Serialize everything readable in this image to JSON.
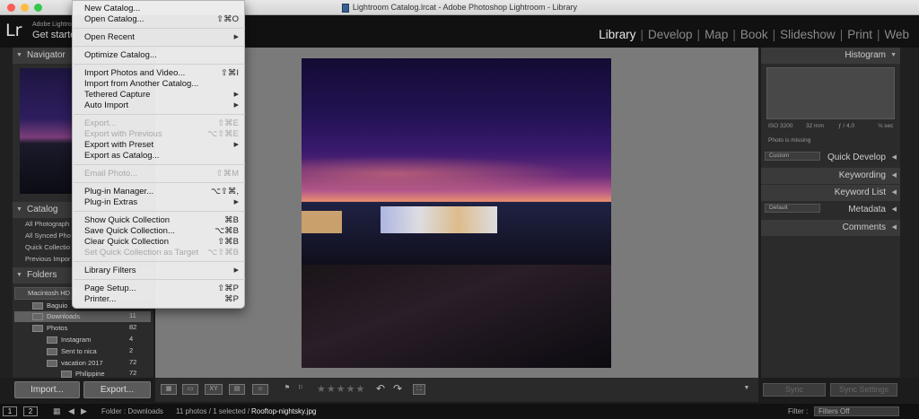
{
  "window": {
    "title": "Lightroom Catalog.lrcat - Adobe Photoshop Lightroom - Library"
  },
  "identity": {
    "logo": "Lr",
    "line1": "Adobe Lightroom",
    "line2": "Get starte"
  },
  "modules": [
    "Library",
    "Develop",
    "Map",
    "Book",
    "Slideshow",
    "Print",
    "Web"
  ],
  "left_panel": {
    "navigator": "Navigator",
    "catalog": "Catalog",
    "catalog_items": [
      "All Photograph",
      "All Synced Pho",
      "Quick Collectio",
      "Previous Impor"
    ],
    "folders": "Folders",
    "drive": "Macintosh HD",
    "folder_rows": [
      {
        "name": "Baguio",
        "count": ""
      },
      {
        "name": "Downloads",
        "count": "11"
      },
      {
        "name": "Photos",
        "count": "82"
      },
      {
        "name": "Instagram",
        "count": "4"
      },
      {
        "name": "Sent to nica",
        "count": "2"
      },
      {
        "name": "vacation 2017",
        "count": "72"
      },
      {
        "name": "Philippine",
        "count": "72"
      }
    ],
    "import_btn": "Import...",
    "export_btn": "Export..."
  },
  "right_panel": {
    "histogram": "Histogram",
    "iso": "ISO 3200",
    "focal": "32 mm",
    "aperture": "ƒ / 4,0",
    "shutter": "⅛ sec",
    "missing": "Photo is missing",
    "custom": "Custom",
    "default": "Default",
    "sections": [
      "Quick Develop",
      "Keywording",
      "Keyword List",
      "Metadata",
      "Comments"
    ],
    "sync": "Sync",
    "sync_settings": "Sync Settings"
  },
  "toolbar": {
    "stars": "★★★★★"
  },
  "filmstrip": {
    "page1": "1",
    "page2": "2",
    "folder": "Folder : Downloads",
    "count": "11 photos / 1 selected /",
    "file": "Rooftop-nightsky.jpg",
    "filter_label": "Filter :",
    "filter_value": "Filters Off"
  },
  "file_menu": {
    "items": [
      {
        "label": "New Catalog...",
        "shortcut": "",
        "disabled": false
      },
      {
        "label": "Open Catalog...",
        "shortcut": "⇧⌘O",
        "disabled": false
      },
      {
        "label": "Open Recent",
        "shortcut": "",
        "disabled": false
      },
      {
        "label": "Optimize Catalog...",
        "shortcut": "",
        "disabled": false
      },
      {
        "label": "Import Photos and Video...",
        "shortcut": "⇧⌘I",
        "disabled": false
      },
      {
        "label": "Import from Another Catalog...",
        "shortcut": "",
        "disabled": false
      },
      {
        "label": "Tethered Capture",
        "shortcut": "",
        "disabled": false
      },
      {
        "label": "Auto Import",
        "shortcut": "",
        "disabled": false
      },
      {
        "label": "Export...",
        "shortcut": "⇧⌘E",
        "disabled": true
      },
      {
        "label": "Export with Previous",
        "shortcut": "⌥⇧⌘E",
        "disabled": true
      },
      {
        "label": "Export with Preset",
        "shortcut": "",
        "disabled": false
      },
      {
        "label": "Export as Catalog...",
        "shortcut": "",
        "disabled": false
      },
      {
        "label": "Email Photo...",
        "shortcut": "⇧⌘M",
        "disabled": true
      },
      {
        "label": "Plug-in Manager...",
        "shortcut": "⌥⇧⌘,",
        "disabled": false
      },
      {
        "label": "Plug-in Extras",
        "shortcut": "",
        "disabled": false
      },
      {
        "label": "Show Quick Collection",
        "shortcut": "⌘B",
        "disabled": false
      },
      {
        "label": "Save Quick Collection...",
        "shortcut": "⌥⌘B",
        "disabled": false
      },
      {
        "label": "Clear Quick Collection",
        "shortcut": "⇧⌘B",
        "disabled": false
      },
      {
        "label": "Set Quick Collection as Target",
        "shortcut": "⌥⇧⌘B",
        "disabled": true
      },
      {
        "label": "Library Filters",
        "shortcut": "",
        "disabled": false
      },
      {
        "label": "Page Setup...",
        "shortcut": "⇧⌘P",
        "disabled": false
      },
      {
        "label": "Printer...",
        "shortcut": "⌘P",
        "disabled": false
      }
    ]
  },
  "colors": {
    "close": "#fc5d57",
    "minimize": "#fdbc40",
    "zoom": "#34c84a"
  }
}
